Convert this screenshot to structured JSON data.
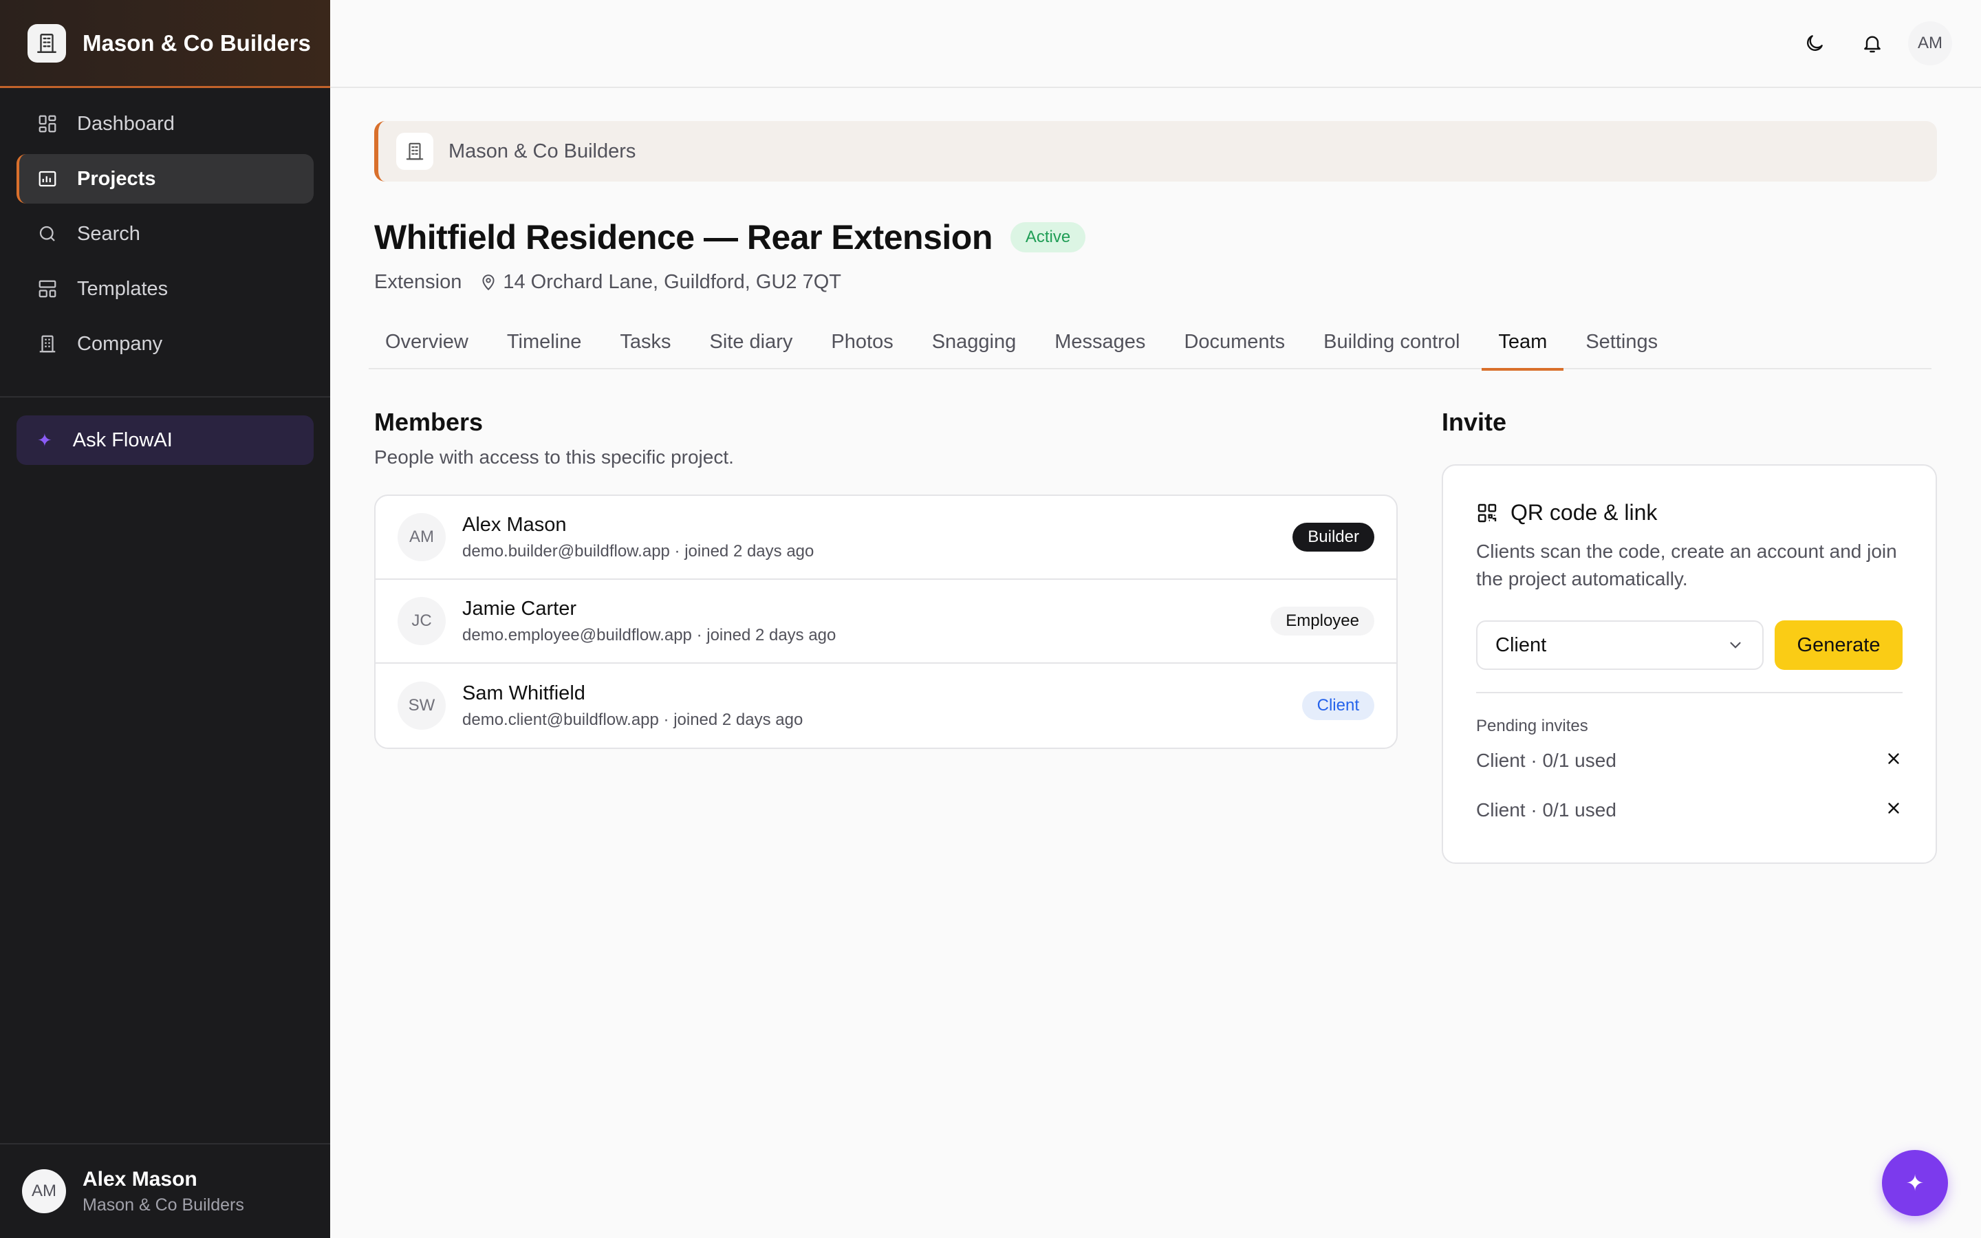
{
  "sidebar": {
    "brand": "Mason & Co Builders",
    "nav": [
      {
        "label": "Dashboard",
        "icon": "dashboard-icon"
      },
      {
        "label": "Projects",
        "icon": "projects-icon",
        "active": true
      },
      {
        "label": "Search",
        "icon": "search-icon"
      },
      {
        "label": "Templates",
        "icon": "templates-icon"
      },
      {
        "label": "Company",
        "icon": "company-icon"
      }
    ],
    "ask": "Ask FlowAI",
    "user": {
      "initials": "AM",
      "name": "Alex Mason",
      "org": "Mason & Co Builders"
    }
  },
  "topbar": {
    "avatar": "AM",
    "icons": [
      "moon-icon",
      "bell-icon"
    ]
  },
  "banner": {
    "company": "Mason & Co Builders"
  },
  "project": {
    "title": "Whitfield Residence — Rear Extension",
    "status": "Active",
    "type": "Extension",
    "address": "14 Orchard Lane, Guildford, GU2 7QT"
  },
  "tabs": [
    "Overview",
    "Timeline",
    "Tasks",
    "Site diary",
    "Photos",
    "Snagging",
    "Messages",
    "Documents",
    "Building control",
    "Team",
    "Settings"
  ],
  "active_tab": "Team",
  "members": {
    "title": "Members",
    "subtitle": "People with access to this specific project.",
    "rows": [
      {
        "initials": "AM",
        "name": "Alex Mason",
        "meta": "demo.builder@buildflow.app · joined 2 days ago",
        "role": "Builder"
      },
      {
        "initials": "JC",
        "name": "Jamie Carter",
        "meta": "demo.employee@buildflow.app · joined 2 days ago",
        "role": "Employee"
      },
      {
        "initials": "SW",
        "name": "Sam Whitfield",
        "meta": "demo.client@buildflow.app · joined 2 days ago",
        "role": "Client"
      }
    ]
  },
  "invite": {
    "title": "Invite",
    "card_title": "QR code & link",
    "description": "Clients scan the code, create an account and join the project automatically.",
    "selected_role": "Client",
    "generate": "Generate",
    "pending_label": "Pending invites",
    "pending": [
      "Client · 0/1 used",
      "Client · 0/1 used"
    ]
  },
  "colors": {
    "accent": "#d9702c",
    "generate": "#facc15",
    "fab": "#7c3aed",
    "sidebar": "#1b1b1d"
  }
}
